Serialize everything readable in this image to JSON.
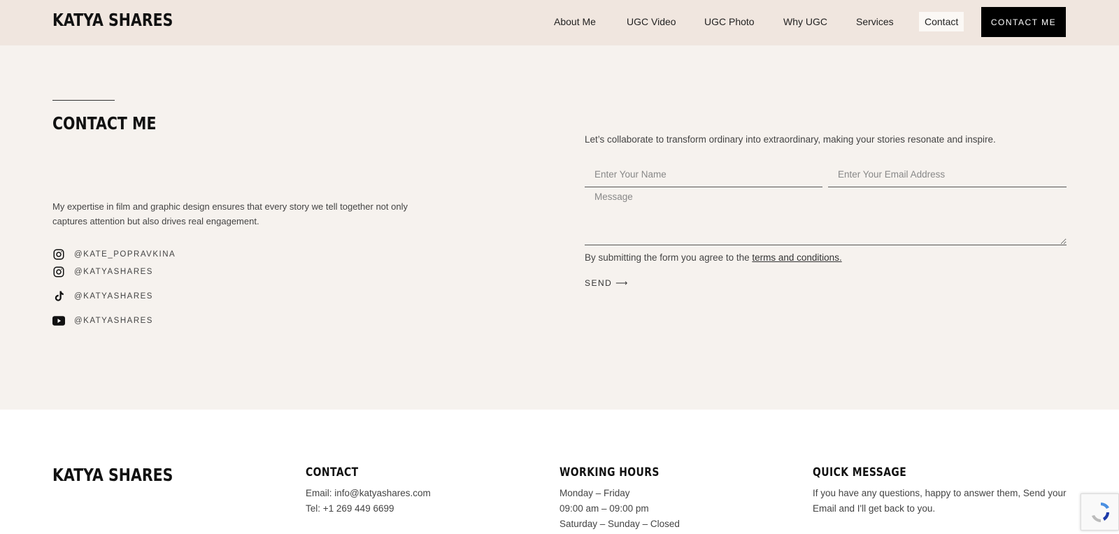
{
  "header": {
    "logo": "KATYA SHARES",
    "nav": [
      "About Me",
      "UGC Video",
      "UGC Photo",
      "Why UGC",
      "Services",
      "Contact"
    ],
    "cta": "CONTACT ME"
  },
  "contact": {
    "title": "CONTACT ME",
    "intro": "My expertise in film and graphic design ensures that every story we tell together not only captures attention but also drives real engagement.",
    "socials": [
      {
        "icon": "instagram-icon",
        "handle": "@KATE_POPRAVKINA"
      },
      {
        "icon": "instagram-icon",
        "handle": "@KATYASHARES"
      },
      {
        "icon": "tiktok-icon",
        "handle": "@KATYASHARES"
      },
      {
        "icon": "youtube-icon",
        "handle": "@KATYASHARES"
      }
    ],
    "lead": "Let’s collaborate to transform ordinary into extraordinary, making your stories resonate and inspire.",
    "form": {
      "name_placeholder": "Enter Your Name",
      "email_placeholder": "Enter Your Email Address",
      "message_placeholder": "Message",
      "terms_prefix": "By submitting the form you agree to the ",
      "terms_link": "terms and conditions.",
      "send": "SEND ⟶"
    }
  },
  "footer": {
    "logo": "KATYA SHARES",
    "contact_heading": "CONTACT",
    "email": "Email: info@katyashares.com",
    "tel": "Tel: +1 269 449 6699",
    "hours_heading": "WORKING HOURS",
    "hours": [
      "Monday – Friday",
      "09:00 am – 09:00 pm",
      "Saturday – Sunday – Closed"
    ],
    "quick_heading": "QUICK MESSAGE",
    "quick_text_1": "If you have any questions, happy to answer them, Send your",
    "quick_text_2": "Email and I'll get back to you."
  }
}
